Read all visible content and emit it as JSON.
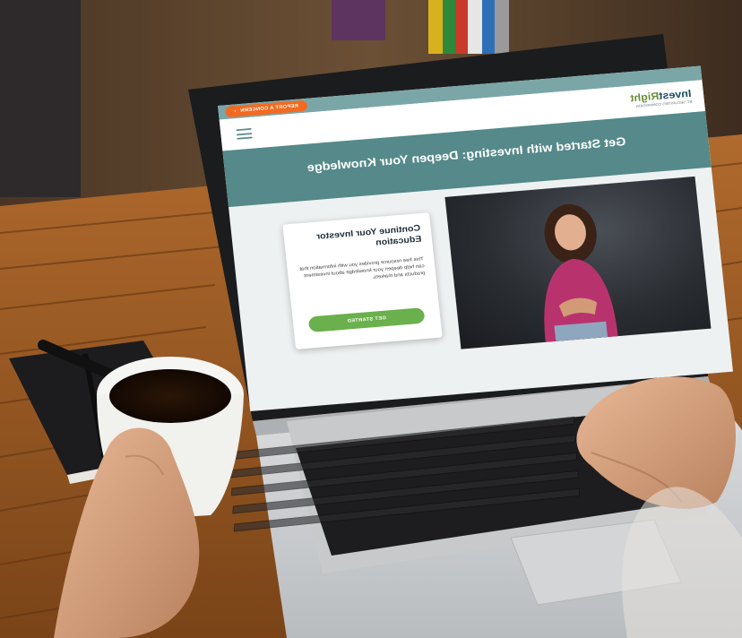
{
  "website": {
    "topbar": {
      "concern_label": "REPORT A CONCERN",
      "chevron_icon": "chevron-right-icon"
    },
    "logo": {
      "invest": "Invest",
      "right": "Right",
      "tagline": "BC SECURITIES COMMISSION"
    },
    "menu_icon": "hamburger-menu-icon",
    "hero": {
      "title": "Get Started with Investing: Deepen Your Knowledge"
    },
    "card": {
      "title": "Continue Your Investor Education",
      "body": "This free resource provides you with information that can help deepen your knowledge about investment products and markets.",
      "button_label": "GET STARTED"
    }
  },
  "colors": {
    "teal_band": "#55898a",
    "topbar": "#7ba6a7",
    "concern_orange": "#f26a21",
    "cta_green": "#6ab04c",
    "logo_navy": "#1e4b63",
    "logo_green": "#6d8f39"
  }
}
